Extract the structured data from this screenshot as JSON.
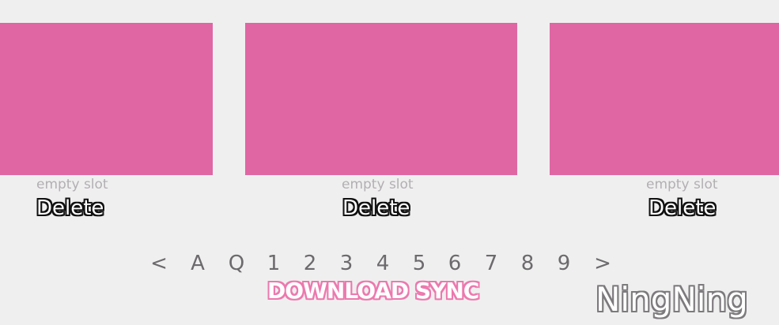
{
  "slots": [
    {
      "status": "empty slot",
      "delete_label": "Delete"
    },
    {
      "status": "empty slot",
      "delete_label": "Delete"
    },
    {
      "status": "empty slot",
      "delete_label": "Delete"
    }
  ],
  "pager": {
    "prev": "<",
    "items": [
      "A",
      "Q",
      "1",
      "2",
      "3",
      "4",
      "5",
      "6",
      "7",
      "8",
      "9"
    ],
    "next": ">"
  },
  "download_sync_label": "DOWNLOAD SYNC",
  "watermark": "NingNing",
  "colors": {
    "background": "#f0eff0",
    "slot_thumbnail": "#df66a3",
    "slot_status_text": "#b2afb2",
    "pager_text": "#6c6a6c",
    "download_sync_outline": "#ec79ae"
  }
}
